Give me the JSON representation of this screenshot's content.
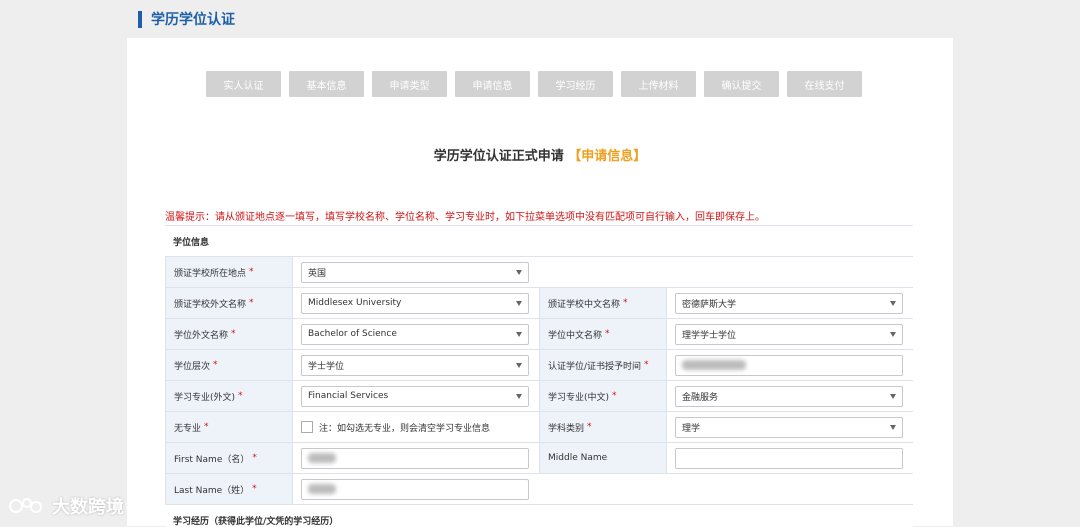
{
  "page_title": "学历学位认证",
  "steps": [
    "实人认证",
    "基本信息",
    "申请类型",
    "申请信息",
    "学习经历",
    "上传材料",
    "确认提交",
    "在线支付"
  ],
  "form_heading": {
    "main": "学历学位认证正式申请",
    "highlight": "【申请信息】"
  },
  "notice": "温馨提示：请从颁证地点逐一填写，填写学校名称、学位名称、学习专业时，如下拉菜单选项中没有匹配项可自行输入，回车即保存上。",
  "degree_section_title": "学位信息",
  "fields": {
    "school_location": {
      "label": "颁证学校所在地点",
      "value": "英国"
    },
    "school_foreign_name": {
      "label": "颁证学校外文名称",
      "value": "Middlesex University"
    },
    "school_chinese_name": {
      "label": "颁证学校中文名称",
      "value": "密德萨斯大学"
    },
    "degree_foreign_name": {
      "label": "学位外文名称",
      "value": "Bachelor of Science"
    },
    "degree_chinese_name": {
      "label": "学位中文名称",
      "value": "理学学士学位"
    },
    "degree_level": {
      "label": "学位层次",
      "value": "学士学位"
    },
    "grant_time": {
      "label": "认证学位/证书授予时间"
    },
    "major_foreign": {
      "label": "学习专业(外文)",
      "value": "Financial Services"
    },
    "major_chinese": {
      "label": "学习专业(中文)",
      "value": "金融服务"
    },
    "no_major": {
      "label": "无专业",
      "checkbox_text": "注：如勾选无专业，则会清空学习专业信息"
    },
    "discipline": {
      "label": "学科类别",
      "value": "理学"
    },
    "first_name": {
      "label": "First Name（名）"
    },
    "middle_name": {
      "label": "Middle Name"
    },
    "last_name": {
      "label": "Last Name（姓）"
    }
  },
  "study_section_title": "学习经历（获得此学位/文凭的学习经历）",
  "watermark": "大数跨境"
}
